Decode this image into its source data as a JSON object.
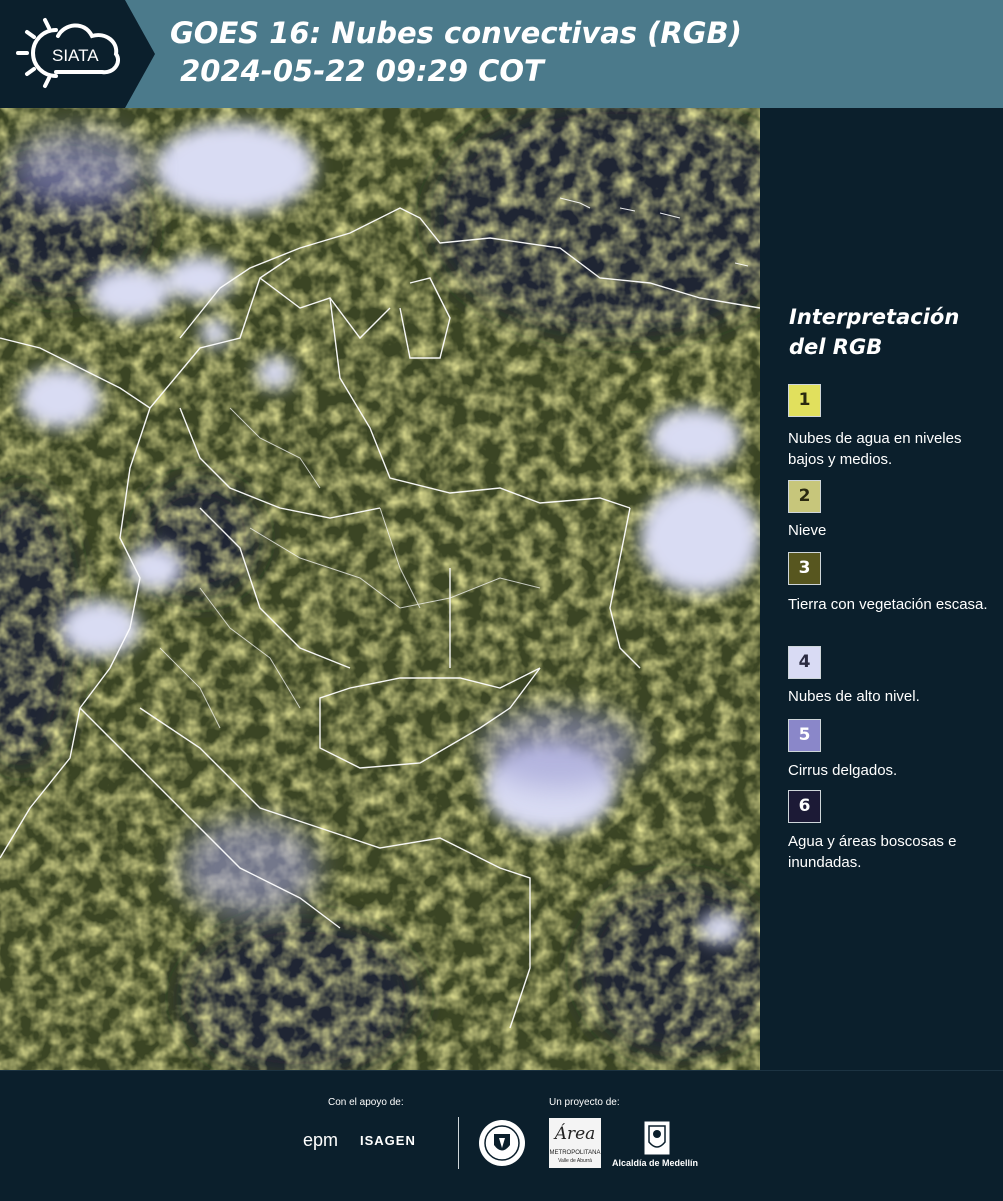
{
  "header": {
    "logo_text": "SIATA",
    "title": "GOES 16: Nubes convectivas (RGB)\n 2024-05-22 09:29 COT"
  },
  "colors": {
    "header_bg": "#4b7a8b",
    "panel_bg": "#0b1f2c",
    "low_clouds": "#e4e15a",
    "high_clouds": "#d8d9f2",
    "vegetation": "#5b5a20",
    "water": "#1c1a34"
  },
  "legend": {
    "title": "Interpretación del RGB",
    "items": [
      {
        "number": "1",
        "color": "#e1e05d",
        "text_color": "#2a2a10",
        "label": "Nubes de agua en niveles bajos y medios."
      },
      {
        "number": "2",
        "color": "#c7c67b",
        "text_color": "#2a2a10",
        "label": "Nieve"
      },
      {
        "number": "3",
        "color": "#57561f",
        "text_color": "#ffffff",
        "label": "Tierra con vegetación escasa."
      },
      {
        "number": "4",
        "color": "#d9dbf4",
        "text_color": "#2a2a40",
        "label": "Nubes de alto nivel."
      },
      {
        "number": "5",
        "color": "#8a87c9",
        "text_color": "#ffffff",
        "label": "Cirrus delgados."
      },
      {
        "number": "6",
        "color": "#1c1a36",
        "text_color": "#ffffff",
        "label": "Agua y áreas boscosas e inundadas."
      }
    ]
  },
  "footer": {
    "support_label": "Con el apoyo de:",
    "project_label": "Un proyecto de:",
    "epm": "epm",
    "isagen": "ISAGEN",
    "amva_main": "Área",
    "amva_sub1": "METROPOLITANA",
    "amva_sub2": "Valle de Aburrá",
    "alcaldia": "Alcaldía de Medellín"
  }
}
